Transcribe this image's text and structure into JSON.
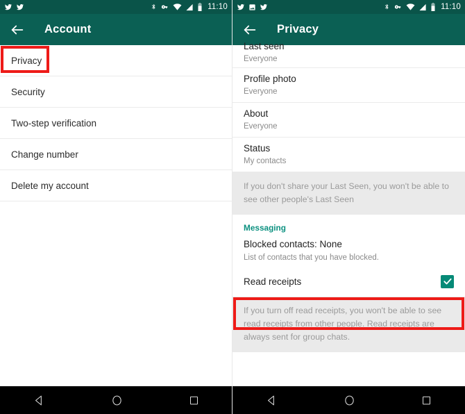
{
  "left_panel": {
    "status_bar": {
      "icons": [
        "twitter-icon",
        "twitter-icon"
      ],
      "system_icons": [
        "bluetooth-icon",
        "vpn-key-icon",
        "wifi-icon",
        "signal-icon",
        "battery-icon"
      ],
      "time": "11:10"
    },
    "toolbar": {
      "back": "back-arrow",
      "title": "Account"
    },
    "items": [
      {
        "label": "Privacy",
        "highlighted": true
      },
      {
        "label": "Security",
        "highlighted": false
      },
      {
        "label": "Two-step verification",
        "highlighted": false
      },
      {
        "label": "Change number",
        "highlighted": false
      },
      {
        "label": "Delete my account",
        "highlighted": false
      }
    ],
    "nav": [
      "back-nav-icon",
      "home-nav-icon",
      "recents-nav-icon"
    ]
  },
  "right_panel": {
    "status_bar": {
      "icons": [
        "twitter-icon",
        "photo-icon",
        "twitter-icon"
      ],
      "system_icons": [
        "bluetooth-icon",
        "vpn-key-icon",
        "wifi-icon",
        "signal-icon",
        "battery-icon"
      ],
      "time": "11:10"
    },
    "toolbar": {
      "back": "back-arrow",
      "title": "Privacy"
    },
    "privacy_items": [
      {
        "title": "Last seen",
        "value": "Everyone"
      },
      {
        "title": "Profile photo",
        "value": "Everyone"
      },
      {
        "title": "About",
        "value": "Everyone"
      },
      {
        "title": "Status",
        "value": "My contacts"
      }
    ],
    "last_seen_note": "If you don't share your Last Seen, you won't be able to see other people's Last Seen",
    "messaging_section": {
      "header": "Messaging",
      "blocked": {
        "title": "Blocked contacts: None",
        "sub": "List of contacts that you have blocked."
      },
      "read_receipts": {
        "label": "Read receipts",
        "checked": true,
        "highlighted": true
      },
      "read_receipts_note": "If you turn off read receipts, you won't be able to see read receipts from other people. Read receipts are always sent for group chats."
    },
    "nav": [
      "back-nav-icon",
      "home-nav-icon",
      "recents-nav-icon"
    ]
  },
  "colors": {
    "status_bar": "#0a5449",
    "toolbar": "#0b6054",
    "accent_green": "#0c9180",
    "checkbox_green": "#068a77",
    "highlight_red": "#ee1b18",
    "info_bg": "#eaeaea"
  }
}
